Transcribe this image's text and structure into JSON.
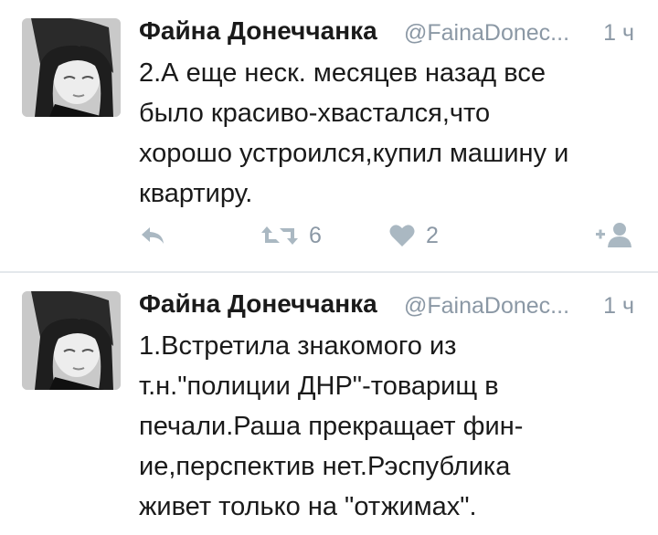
{
  "tweets": [
    {
      "author_name": "Файна Донеччанка",
      "handle": "@FainaDonec...",
      "time": "1 ч",
      "text_lines": [
        "2.А еще неск. месяцев назад все",
        "было красиво-хвастался,что",
        "хорошо устроился,купил машину и",
        "квартиру."
      ],
      "retweets": "6",
      "likes": "2"
    },
    {
      "author_name": "Файна Донеччанка",
      "handle": "@FainaDonec...",
      "time": "1 ч",
      "text_lines": [
        "1.Встретила знакомого из",
        "т.н.\"полиции ДНР\"-товарищ в",
        "печали.Раша прекращает фин-",
        "ие,перспектив нет.Рэспублика",
        "живет только на \"отжимах\"."
      ]
    }
  ],
  "icons": {
    "reply": "reply-arrow-icon",
    "retweet": "retweet-icon",
    "like": "heart-icon",
    "follow": "add-user-icon"
  },
  "colors": {
    "text": "#1a1a1a",
    "muted": "#8b98a5",
    "icon": "#aab8c2",
    "divider": "#e4e8ec"
  }
}
